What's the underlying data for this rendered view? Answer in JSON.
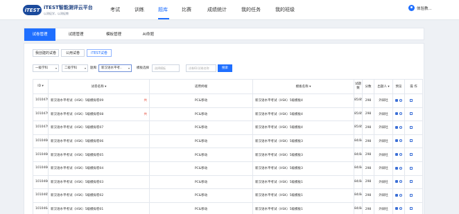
{
  "app": {
    "logo_badge": "iTEST",
    "title": "iTEST智能测评云平台",
    "subtitle": "以测促学，以测促教"
  },
  "nav": {
    "items": [
      "考试",
      "训练",
      "题库",
      "比赛",
      "成绩统计",
      "我的任务",
      "我的班级"
    ],
    "active": "题库"
  },
  "user": {
    "name": "体验教..."
  },
  "tabs": [
    "试卷管理",
    "试题管理",
    "模板管理",
    "AI命题"
  ],
  "subtabs": [
    "我创建的试卷",
    "公用试卷",
    "iTEST试卷"
  ],
  "filters": {
    "grade": "一级学科",
    "subject": "二级学科",
    "question_label": "题库:",
    "question_value": "新汉语水平考..",
    "template_label": "模板选择",
    "template_placeholder": "选择模板",
    "keyword_placeholder": "试卷ID/试卷名称",
    "search_label": "搜索"
  },
  "table": {
    "headers": {
      "id": "ID ▾",
      "name": "试卷名称 ▾",
      "term": "适用终端",
      "template": "模板名称 ▾",
      "count": "试题数",
      "score": "分数",
      "publisher": "出题人 ▾",
      "preview": "预览",
      "ops": "操 作"
    },
    "rows": [
      {
        "id": "10104793",
        "name": "新汉语水平考试（HSK）5级模拟卷09",
        "flag": "共",
        "term": "PC&移动",
        "template": "新汉语水平考试（HSK）5级模板4",
        "count": "85/85",
        "score": "298",
        "publisher": "外研社"
      },
      {
        "id": "10104792",
        "name": "新汉语水平考试（HSK）5级模拟卷08",
        "flag": "共",
        "term": "PC&移动",
        "template": "新汉语水平考试（HSK）5级模板4",
        "count": "85/85",
        "score": "298",
        "publisher": "外研社"
      },
      {
        "id": "10104791",
        "name": "新汉语水平考试（HSK）5级模拟卷07",
        "flag": "",
        "term": "PC&移动",
        "template": "新汉语水平考试（HSK）5级模板4",
        "count": "85/85",
        "score": "298",
        "publisher": "外研社"
      },
      {
        "id": "10104667",
        "name": "新汉语水平考试（HSK）5级模拟卷06",
        "flag": "",
        "term": "PC&移动",
        "template": "新汉语水平考试（HSK）5级模板3",
        "count": "84/84",
        "score": "298",
        "publisher": "外研社"
      },
      {
        "id": "10104666",
        "name": "新汉语水平考试（HSK）5级模拟卷05",
        "flag": "",
        "term": "PC&移动",
        "template": "新汉语水平考试（HSK）5级模板3",
        "count": "84/84",
        "score": "298",
        "publisher": "外研社"
      },
      {
        "id": "10104665",
        "name": "新汉语水平考试（HSK）5级模拟卷04",
        "flag": "",
        "term": "PC&移动",
        "template": "新汉语水平考试（HSK）5级模板3",
        "count": "84/84",
        "score": "298",
        "publisher": "外研社"
      },
      {
        "id": "10104660",
        "name": "新汉语水平考试（HSK）5级模拟卷03",
        "flag": "",
        "term": "PC&移动",
        "template": "新汉语水平考试（HSK）5级模板1",
        "count": "84/84",
        "score": "298",
        "publisher": "外研社"
      },
      {
        "id": "10104659",
        "name": "新汉语水平考试（HSK）5级模拟卷02",
        "flag": "",
        "term": "PC&移动",
        "template": "新汉语水平考试（HSK）5级模板1",
        "count": "84/84",
        "score": "298",
        "publisher": "外研社"
      },
      {
        "id": "10104642",
        "name": "新汉语水平考试（HSK）5级模拟卷01",
        "flag": "",
        "term": "PC&移动",
        "template": "新汉语水平考试（HSK）5级模板1",
        "count": "84/84",
        "score": "298",
        "publisher": "外研社"
      }
    ]
  }
}
